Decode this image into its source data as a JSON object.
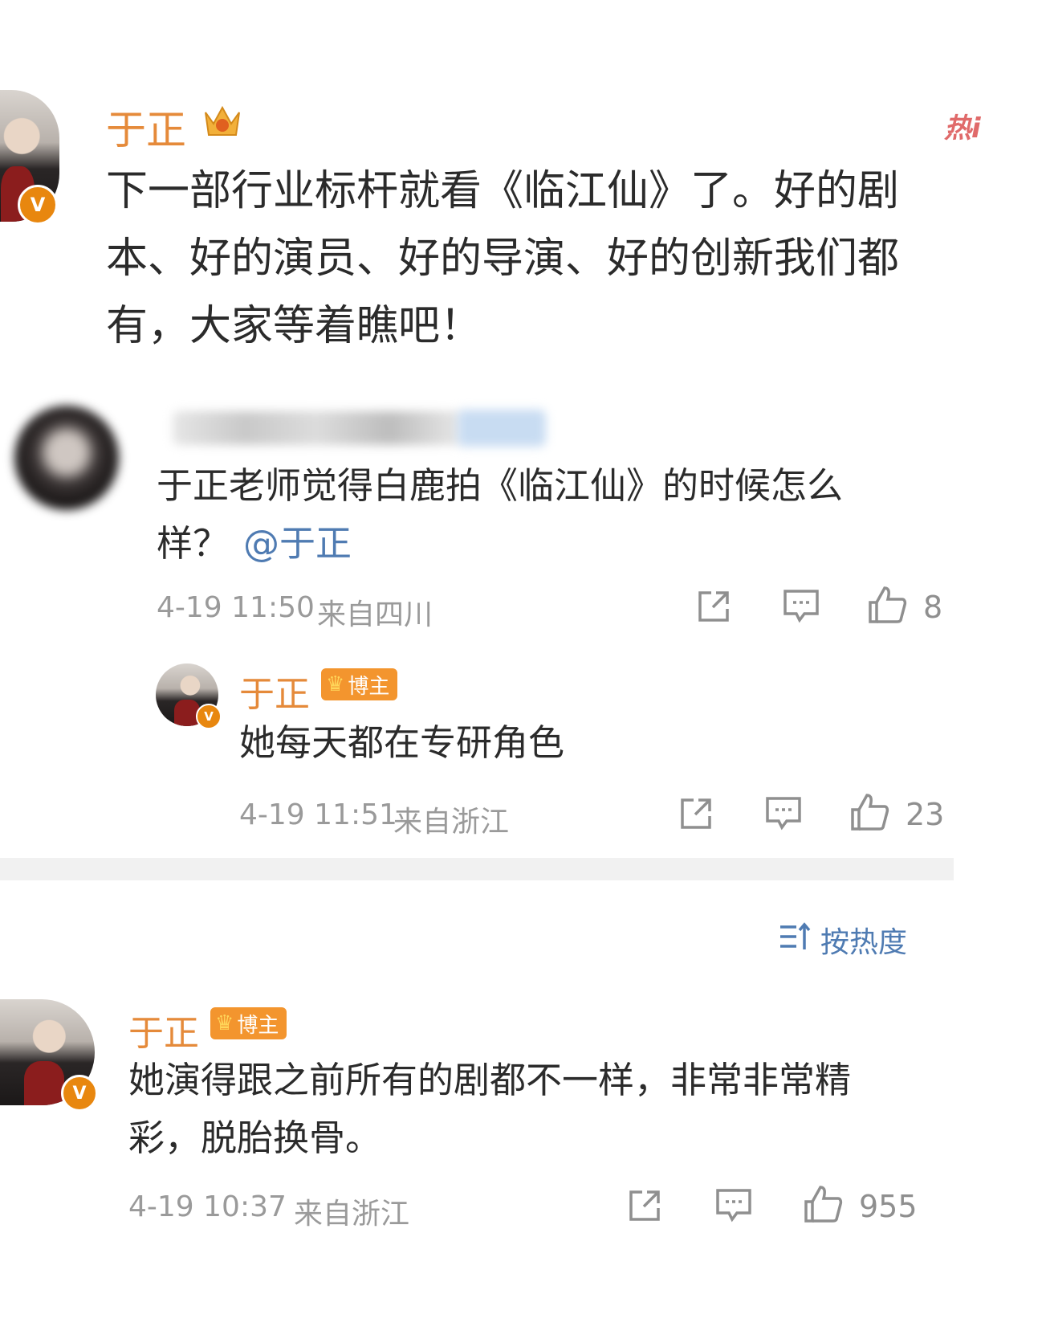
{
  "post": {
    "author": "于正",
    "badge_icon": "crown-icon",
    "hot_tag": "热i",
    "text_lines": [
      "下一部行业标杆就看《临江仙》了。好的剧",
      "本、好的演员、好的导演、好的创新我们都",
      "有，大家等着瞧吧！"
    ]
  },
  "comment1": {
    "text_lines": [
      "于正老师觉得白鹿拍《临江仙》的时候怎么",
      "样？"
    ],
    "mention": "@于正",
    "time": "4-19 11:50",
    "location": "来自四川",
    "likes": "8"
  },
  "reply1": {
    "author": "于正",
    "badge": "博主",
    "text": "她每天都在专研角色",
    "time": "4-19 11:51",
    "location": "来自浙江",
    "likes": "23"
  },
  "sort": {
    "label": "按热度",
    "icon": "sort-icon"
  },
  "comment2": {
    "author": "于正",
    "badge": "博主",
    "text_lines": [
      "她演得跟之前所有的剧都不一样，非常非常精",
      "彩，脱胎换骨。"
    ],
    "time": "4-19 10:37",
    "location": "来自浙江",
    "likes": "955"
  },
  "colors": {
    "name": "#e58a3a",
    "badge": "#f3952e",
    "mention": "#4f7bb2",
    "meta": "#9a9a9a"
  }
}
